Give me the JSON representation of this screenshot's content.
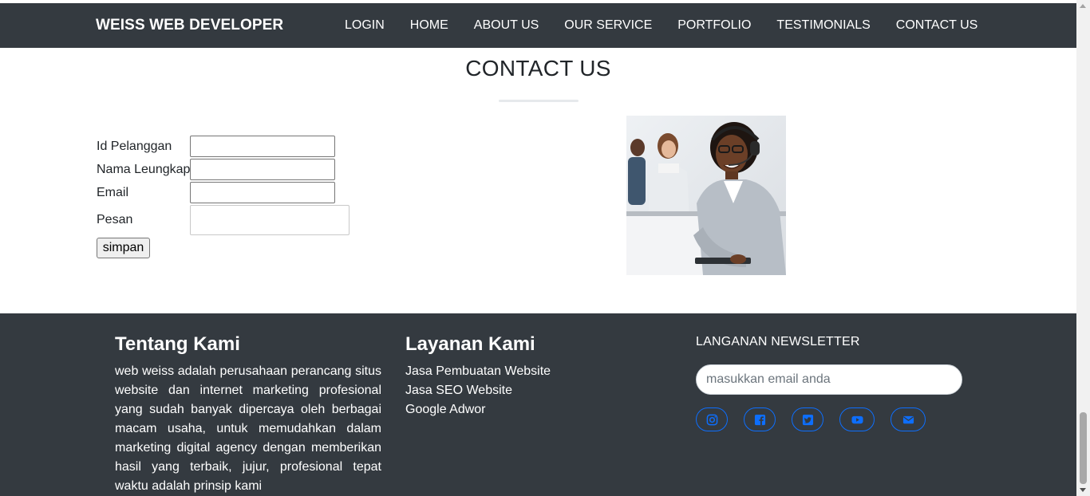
{
  "navbar": {
    "brand": "WEISS WEB DEVELOPER",
    "links": [
      "LOGIN",
      "HOME",
      "ABOUT US",
      "OUR SERVICE",
      "PORTFOLIO",
      "TESTIMONIALS",
      "CONTACT US"
    ]
  },
  "contact": {
    "title": "CONTACT US",
    "form": {
      "id_label": "Id Pelanggan",
      "name_label": "Nama Leungkap",
      "email_label": "Email",
      "message_label": "Pesan",
      "submit_label": "simpan"
    }
  },
  "footer": {
    "about": {
      "heading": "Tentang Kami",
      "text": "web weiss adalah perusahaan perancang situs website dan internet marketing profesional yang sudah banyak dipercaya oleh berbagai macam usaha, untuk memudahkan dalam marketing digital agency dengan memberikan hasil yang terbaik, jujur, profesional tepat waktu adalah prinsip kami"
    },
    "services": {
      "heading": "Layanan Kami",
      "items": [
        "Jasa Pembuatan Website",
        "Jasa SEO Website",
        "Google Adwor"
      ]
    },
    "newsletter": {
      "heading": "LANGANAN NEWSLETTER",
      "placeholder": "masukkan email anda"
    },
    "social_icons": [
      "instagram-icon",
      "facebook-icon",
      "twitter-icon",
      "youtube-icon",
      "envelope-icon"
    ]
  },
  "colors": {
    "navbar_bg": "#343a40",
    "footer_bg": "#343a40",
    "social_accent": "#0d6efd"
  }
}
